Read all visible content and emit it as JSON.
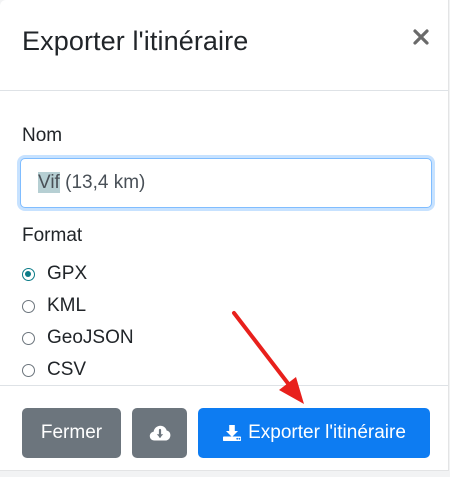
{
  "modal": {
    "title": "Exporter l'itinéraire",
    "close_icon": "close-icon"
  },
  "form": {
    "name_label": "Nom",
    "name_value_selected": "Vif",
    "name_value_rest": " (13,4 km)",
    "format_label": "Format",
    "formats": [
      {
        "label": "GPX",
        "checked": true
      },
      {
        "label": "KML",
        "checked": false
      },
      {
        "label": "GeoJSON",
        "checked": false
      },
      {
        "label": "CSV",
        "checked": false
      }
    ]
  },
  "footer": {
    "close_label": "Fermer",
    "download_icon": "cloud-download-icon",
    "export_label": "Exporter l'itinéraire",
    "export_icon": "download-icon"
  },
  "colors": {
    "primary": "#0d7cf2",
    "secondary": "#6c757d",
    "radio_checked": "#0b7b87",
    "annotation_arrow": "#e8201c"
  }
}
